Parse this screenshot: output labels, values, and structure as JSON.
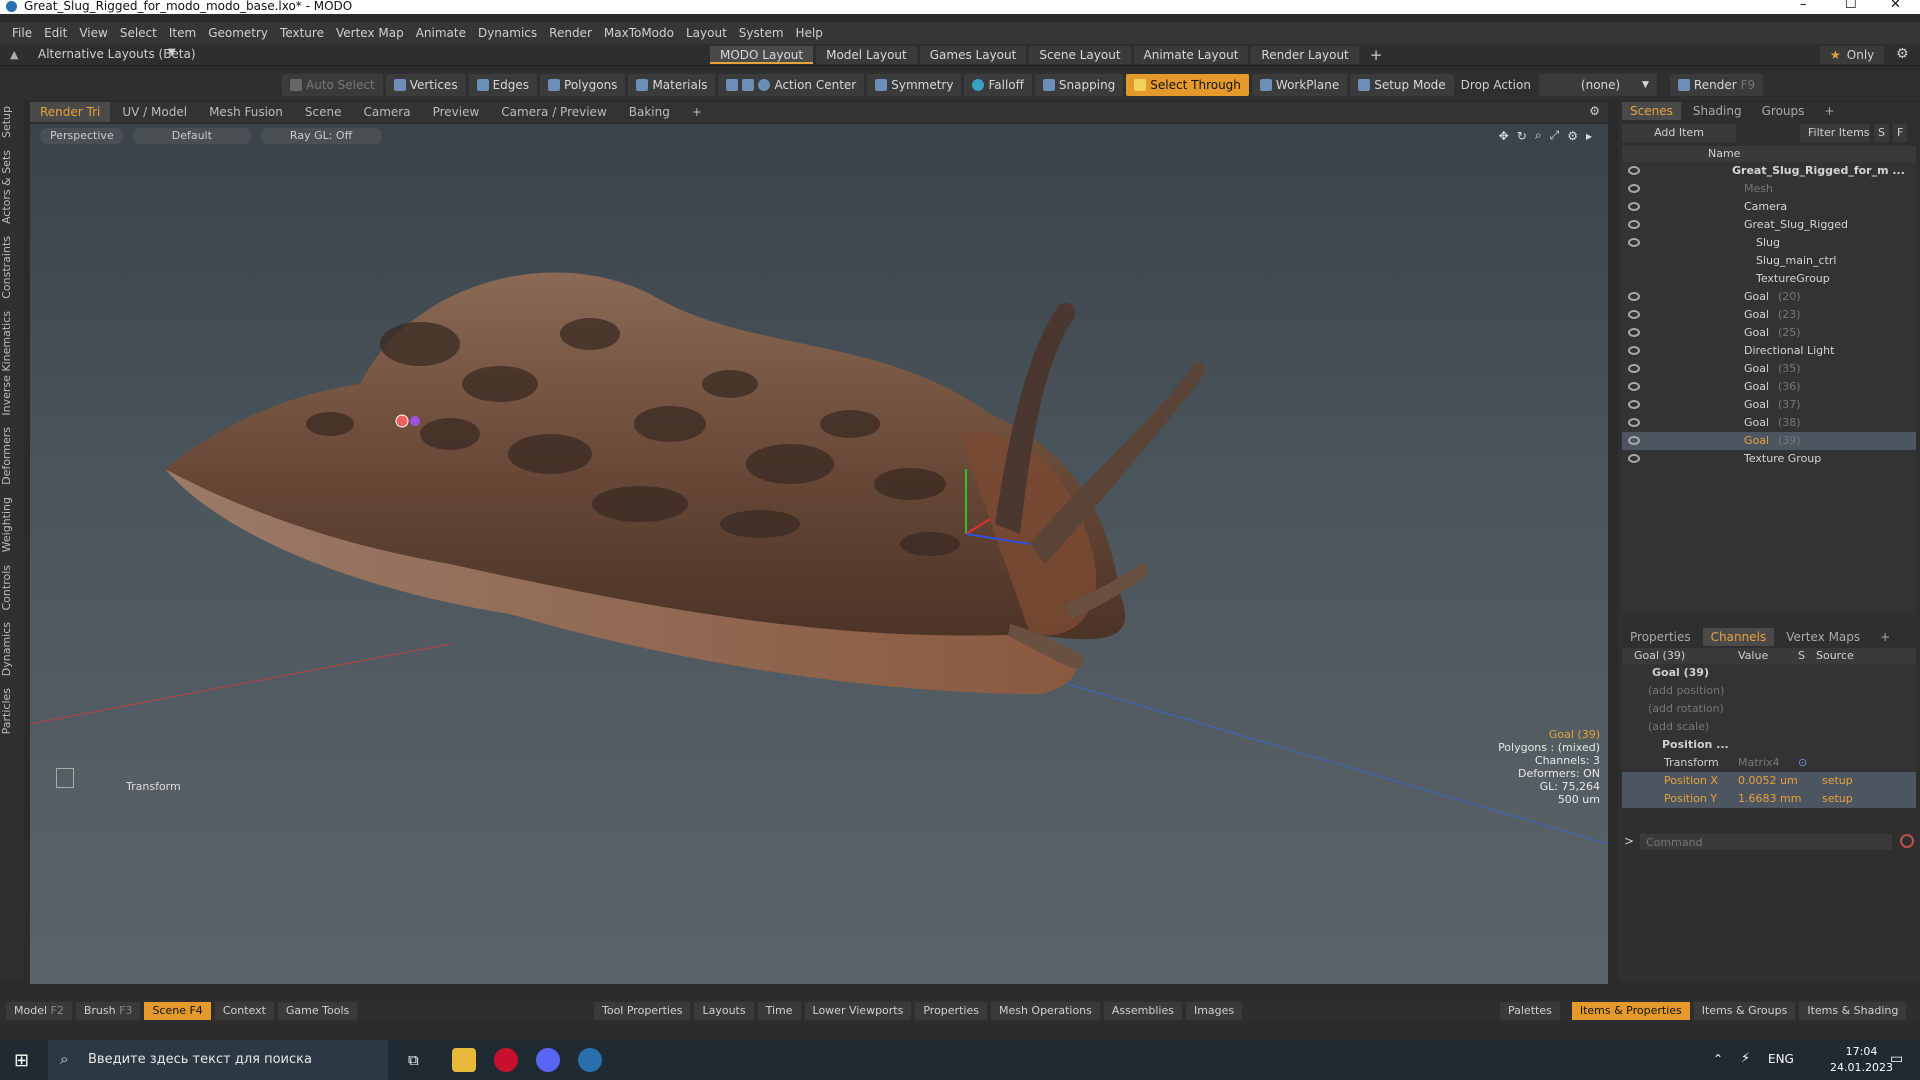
{
  "window": {
    "title": "Great_Slug_Rigged_for_modo_modo_base.lxo* - MODO",
    "min": "–",
    "max": "☐",
    "close": "✕"
  },
  "menu": [
    "File",
    "Edit",
    "View",
    "Select",
    "Item",
    "Geometry",
    "Texture",
    "Vertex Map",
    "Animate",
    "Dynamics",
    "Render",
    "MaxToModo",
    "Layout",
    "System",
    "Help"
  ],
  "layoutbar": {
    "alt_layouts": "Alternative Layouts (Beta)",
    "tabs": [
      "MODO Layout",
      "Model Layout",
      "Games Layout",
      "Scene Layout",
      "Animate Layout",
      "Render Layout"
    ],
    "add": "+",
    "only": "Only"
  },
  "toolbar": {
    "auto_select": "Auto Select",
    "vertices": "Vertices",
    "edges": "Edges",
    "polygons": "Polygons",
    "materials": "Materials",
    "action_center": "Action Center",
    "symmetry": "Symmetry",
    "falloff": "Falloff",
    "snapping": "Snapping",
    "select_through": "Select Through",
    "workplane": "WorkPlane",
    "setup_mode": "Setup Mode",
    "drop_action": "Drop Action",
    "drop_value": "(none)",
    "render": "Render",
    "render_key": "F9"
  },
  "left_tabs": [
    "Setup",
    "Actors & Sets",
    "Constraints",
    "Inverse Kinematics",
    "Deformers",
    "Weighting",
    "Controls",
    "Dynamics",
    "Particles"
  ],
  "viewport_tabs": [
    "Render Tri",
    "UV / Model",
    "Mesh Fusion",
    "Scene",
    "Camera",
    "Preview",
    "Camera / Preview",
    "Baking"
  ],
  "viewport": {
    "perspective": "Perspective",
    "default": "Default",
    "raygl": "Ray GL: Off",
    "transform": "Transform",
    "info": [
      "Goal (39)",
      "Polygons : (mixed)",
      "Channels: 3",
      "Deformers: ON",
      "GL: 75,264",
      "500 um"
    ]
  },
  "scenes": {
    "tabs": [
      "Scenes",
      "Shading",
      "Groups"
    ],
    "add_item": "Add Item",
    "filter": "Filter Items",
    "s": "S",
    "f": "F",
    "col_name": "Name",
    "items": [
      {
        "label": "Great_Slug_Rigged_for_m ...",
        "indent": 0,
        "bold": true,
        "eye": true
      },
      {
        "label": "Mesh",
        "indent": 2,
        "dim": true,
        "eye": true
      },
      {
        "label": "Camera",
        "indent": 2,
        "eye": true
      },
      {
        "label": "Great_Slug_Rigged",
        "indent": 2,
        "eye": true
      },
      {
        "label": "Slug",
        "indent": 3,
        "eye": true
      },
      {
        "label": "Slug_main_ctrl",
        "indent": 3,
        "eye": false
      },
      {
        "label": "TextureGroup",
        "indent": 3,
        "eye": false
      },
      {
        "label": "Goal",
        "suffix": "(20)",
        "indent": 2,
        "eye": true
      },
      {
        "label": "Goal",
        "suffix": "(23)",
        "indent": 2,
        "eye": true
      },
      {
        "label": "Goal",
        "suffix": "(25)",
        "indent": 2,
        "eye": true
      },
      {
        "label": "Directional Light",
        "indent": 2,
        "eye": true
      },
      {
        "label": "Goal",
        "suffix": "(35)",
        "indent": 2,
        "eye": true
      },
      {
        "label": "Goal",
        "suffix": "(36)",
        "indent": 2,
        "eye": true
      },
      {
        "label": "Goal",
        "suffix": "(37)",
        "indent": 2,
        "eye": true
      },
      {
        "label": "Goal",
        "suffix": "(38)",
        "indent": 2,
        "eye": true
      },
      {
        "label": "Goal",
        "suffix": "(39)",
        "indent": 2,
        "eye": true,
        "selected": true
      },
      {
        "label": "Texture Group",
        "indent": 2,
        "eye": true
      }
    ]
  },
  "channels": {
    "tabs": [
      "Properties",
      "Channels",
      "Vertex Maps"
    ],
    "headers": [
      "Goal (39)",
      "Value",
      "S",
      "Source"
    ],
    "root": "Goal (39)",
    "add_position": "(add position)",
    "add_rotation": "(add rotation)",
    "add_scale": "(add scale)",
    "position": "Position ...",
    "transform": {
      "name": "Transform",
      "value": "Matrix4"
    },
    "rows": [
      {
        "name": "Position X",
        "value": "0.0052 um",
        "source": "setup"
      },
      {
        "name": "Position Y",
        "value": "1.6683 mm",
        "source": "setup"
      }
    ],
    "command_placeholder": "Command"
  },
  "bottombar": {
    "left": [
      {
        "label": "Model",
        "key": "F2"
      },
      {
        "label": "Brush",
        "key": "F3"
      },
      {
        "label": "Scene",
        "key": "F4",
        "on": true
      },
      {
        "label": "Context"
      },
      {
        "label": "Game Tools"
      }
    ],
    "mid": [
      "Tool Properties",
      "Layouts",
      "Time",
      "Lower Viewports",
      "Properties",
      "Mesh Operations",
      "Assemblies",
      "Images"
    ],
    "right": [
      {
        "label": "Palettes"
      },
      {
        "label": "Items & Properties",
        "on": true
      },
      {
        "label": "Items & Groups"
      },
      {
        "label": "Items & Shading"
      }
    ]
  },
  "taskbar": {
    "search": "Введите здесь текст для поиска",
    "lang": "ENG",
    "time": "17:04",
    "date": "24.01.2023"
  }
}
